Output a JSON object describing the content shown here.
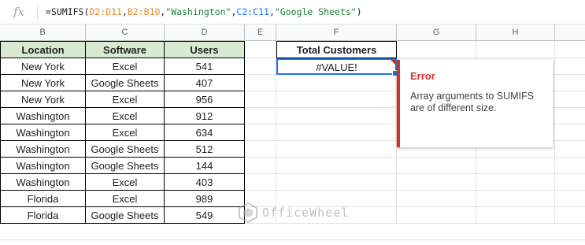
{
  "formula_bar": {
    "fx_label": "fx",
    "tokens": [
      {
        "text": "=SUMIFS(",
        "color": "default"
      },
      {
        "text": "D2:D11",
        "color": "orange"
      },
      {
        "text": ",",
        "color": "default"
      },
      {
        "text": "B2:B10",
        "color": "orange"
      },
      {
        "text": ",",
        "color": "default"
      },
      {
        "text": "\"Washington\"",
        "color": "green"
      },
      {
        "text": ",",
        "color": "default"
      },
      {
        "text": "C2:C11",
        "color": "blue"
      },
      {
        "text": ",",
        "color": "default"
      },
      {
        "text": "\"Google Sheets\"",
        "color": "green"
      },
      {
        "text": ")",
        "color": "default"
      }
    ]
  },
  "columns": [
    "B",
    "C",
    "D",
    "E",
    "F",
    "G",
    "H"
  ],
  "table": {
    "headers": [
      "Location",
      "Software",
      "Users"
    ],
    "rows": [
      [
        "New York",
        "Excel",
        "541"
      ],
      [
        "New York",
        "Google Sheets",
        "407"
      ],
      [
        "New York",
        "Excel",
        "956"
      ],
      [
        "Washington",
        "Excel",
        "912"
      ],
      [
        "Washington",
        "Excel",
        "634"
      ],
      [
        "Washington",
        "Google Sheets",
        "512"
      ],
      [
        "Washington",
        "Google Sheets",
        "144"
      ],
      [
        "Washington",
        "Excel",
        "403"
      ],
      [
        "Florida",
        "Excel",
        "989"
      ],
      [
        "Florida",
        "Google Sheets",
        "549"
      ]
    ]
  },
  "summary": {
    "header": "Total Customers",
    "value": "#VALUE!"
  },
  "error_popup": {
    "title": "Error",
    "message": "Array arguments to SUMIFS are of different size."
  },
  "watermark": {
    "text": "OfficeWheel"
  },
  "colors": {
    "header_fill": "#d9ead3",
    "selection": "#1a73e8",
    "error": "#d93025",
    "range_orange": "#e6892e",
    "string_green": "#188038",
    "range_blue": "#1a73e8"
  }
}
